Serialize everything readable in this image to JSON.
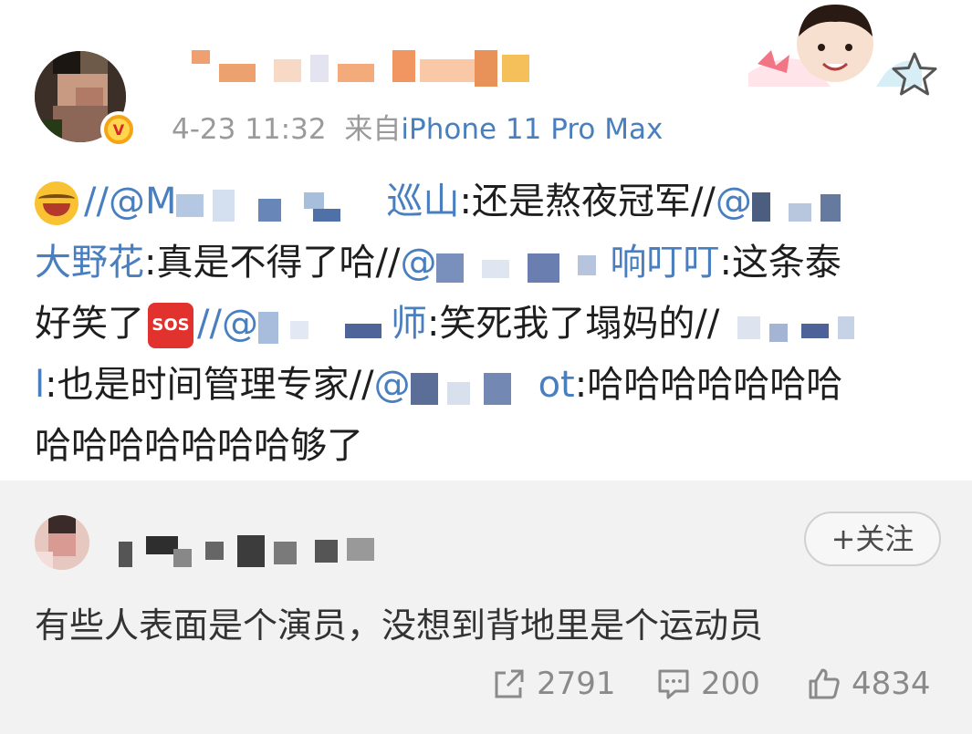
{
  "post": {
    "timestamp": "4-23 11:32",
    "source_prefix": "来自",
    "source_device": "iPhone 11 Pro Max",
    "lines": {
      "l1_at1": "//@M",
      "l1_tail_at": "巡山",
      "l1_text": ":还是熬夜冠军//",
      "l1_at2": "@",
      "l2_at": "大野花",
      "l2_text": ":真是不得了哈//",
      "l2_at2": "@",
      "l2_tail_at": "响叮叮",
      "l2_text2": ":这条泰",
      "l3_text": "好笑了",
      "l3_at": "//@",
      "l3_tail_at": "师",
      "l3_text2": ":笑死我了塌妈的//",
      "l4_at": "l",
      "l4_text": ":也是时间管理专家//",
      "l4_at2": "@",
      "l4_tail_at": "ot",
      "l4_text2": ":哈哈哈哈哈哈哈",
      "l5_text": "哈哈哈哈哈哈哈够了"
    },
    "sos_label": "SOS"
  },
  "comment": {
    "follow_label": "+关注",
    "text": "有些人表面是个演员，没想到背地里是个运动员",
    "reposts": "2791",
    "comments": "200",
    "likes": "4834"
  },
  "colors": {
    "link": "#4a7fbf",
    "meta": "#9a9a9a",
    "comment_bg": "#f2f2f2",
    "verified": "#f4a416"
  },
  "icons": [
    "verified-badge-icon",
    "star-icon",
    "laugh-cry-emoji-icon",
    "sos-emoji-icon",
    "repost-icon",
    "comment-icon",
    "like-icon"
  ]
}
